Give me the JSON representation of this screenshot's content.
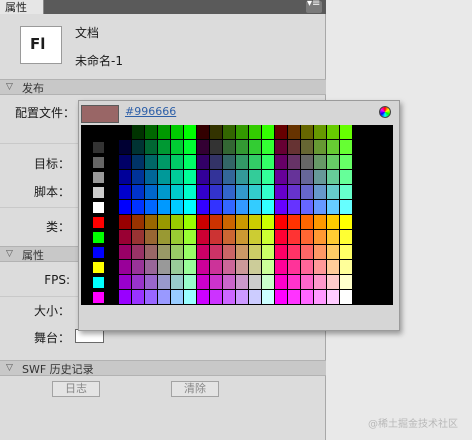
{
  "panel": {
    "tab_label": "属性",
    "menu_glyph": "▾≡",
    "doc_icon_text": "Fl",
    "doc_type": "文档",
    "doc_name": "未命名-1"
  },
  "sections": {
    "publish": {
      "arrow": "▽",
      "title": "发布"
    },
    "properties": {
      "arrow": "▽",
      "title": "属性"
    },
    "swf_history": {
      "arrow": "▽",
      "title": "SWF 历史记录"
    }
  },
  "publish": {
    "profile_label": "配置文件：",
    "target_label": "目标：",
    "script_label": "脚本：",
    "class_label": "类："
  },
  "properties": {
    "fps_label": "FPS:",
    "size_label": "大小：",
    "stage_label": "舞台："
  },
  "history": {
    "log_button": "日志",
    "clear_button": "清除"
  },
  "picker": {
    "hex_value": "#996666",
    "current_color": "#996666"
  },
  "colors": {
    "stage_color": "#ffffff",
    "hex_link": "#2d5fa8"
  },
  "watermark": "@稀土掘金技术社区"
}
